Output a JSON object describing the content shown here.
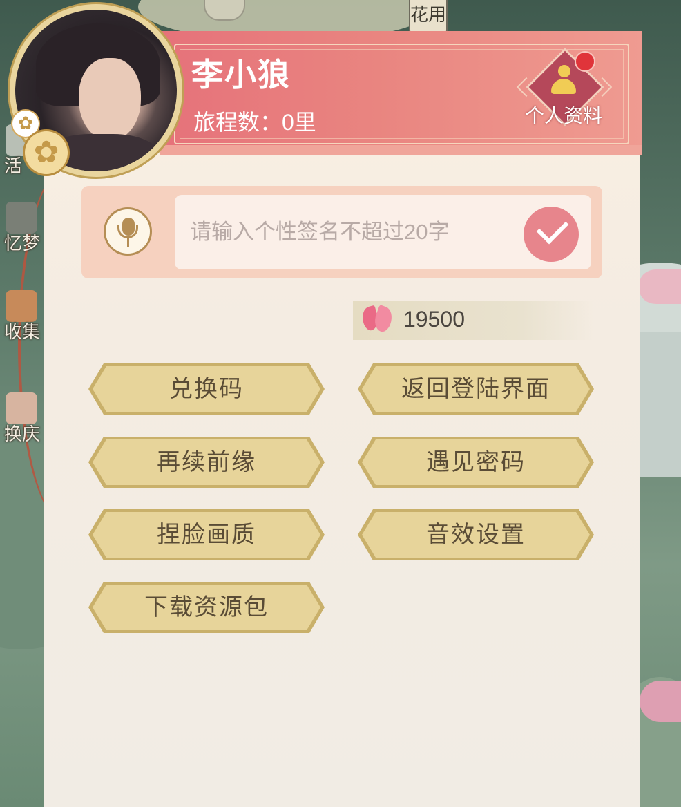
{
  "top_tab": {
    "label": "花用"
  },
  "sidebar": {
    "items": [
      {
        "label": "活",
        "icon": "event-icon"
      },
      {
        "label": "忆梦",
        "icon": "dream-icon"
      },
      {
        "label": "收集",
        "icon": "collection-icon"
      },
      {
        "label": "换庆",
        "icon": "exchange-icon"
      }
    ]
  },
  "profile": {
    "username": "李小狼",
    "journey_text": "旅程数：0里",
    "personal_info_label": "个人资料"
  },
  "signature": {
    "placeholder": "请输入个性签名不超过20字",
    "value": ""
  },
  "currency": {
    "amount": "19500",
    "icon": "butterfly-icon"
  },
  "buttons": {
    "redeem_code": "兑换码",
    "return_login": "返回登陆界面",
    "continue_fate": "再续前缘",
    "meet_code": "遇见密码",
    "face_quality": "捏脸画质",
    "sound_settings": "音效设置",
    "download_pack": "下载资源包"
  },
  "colors": {
    "banner": "#e6727a",
    "button_fill": "#e7d49a",
    "button_border": "#c9b06a",
    "notification_dot": "#e0343a",
    "confirm_button": "#e7858c"
  }
}
